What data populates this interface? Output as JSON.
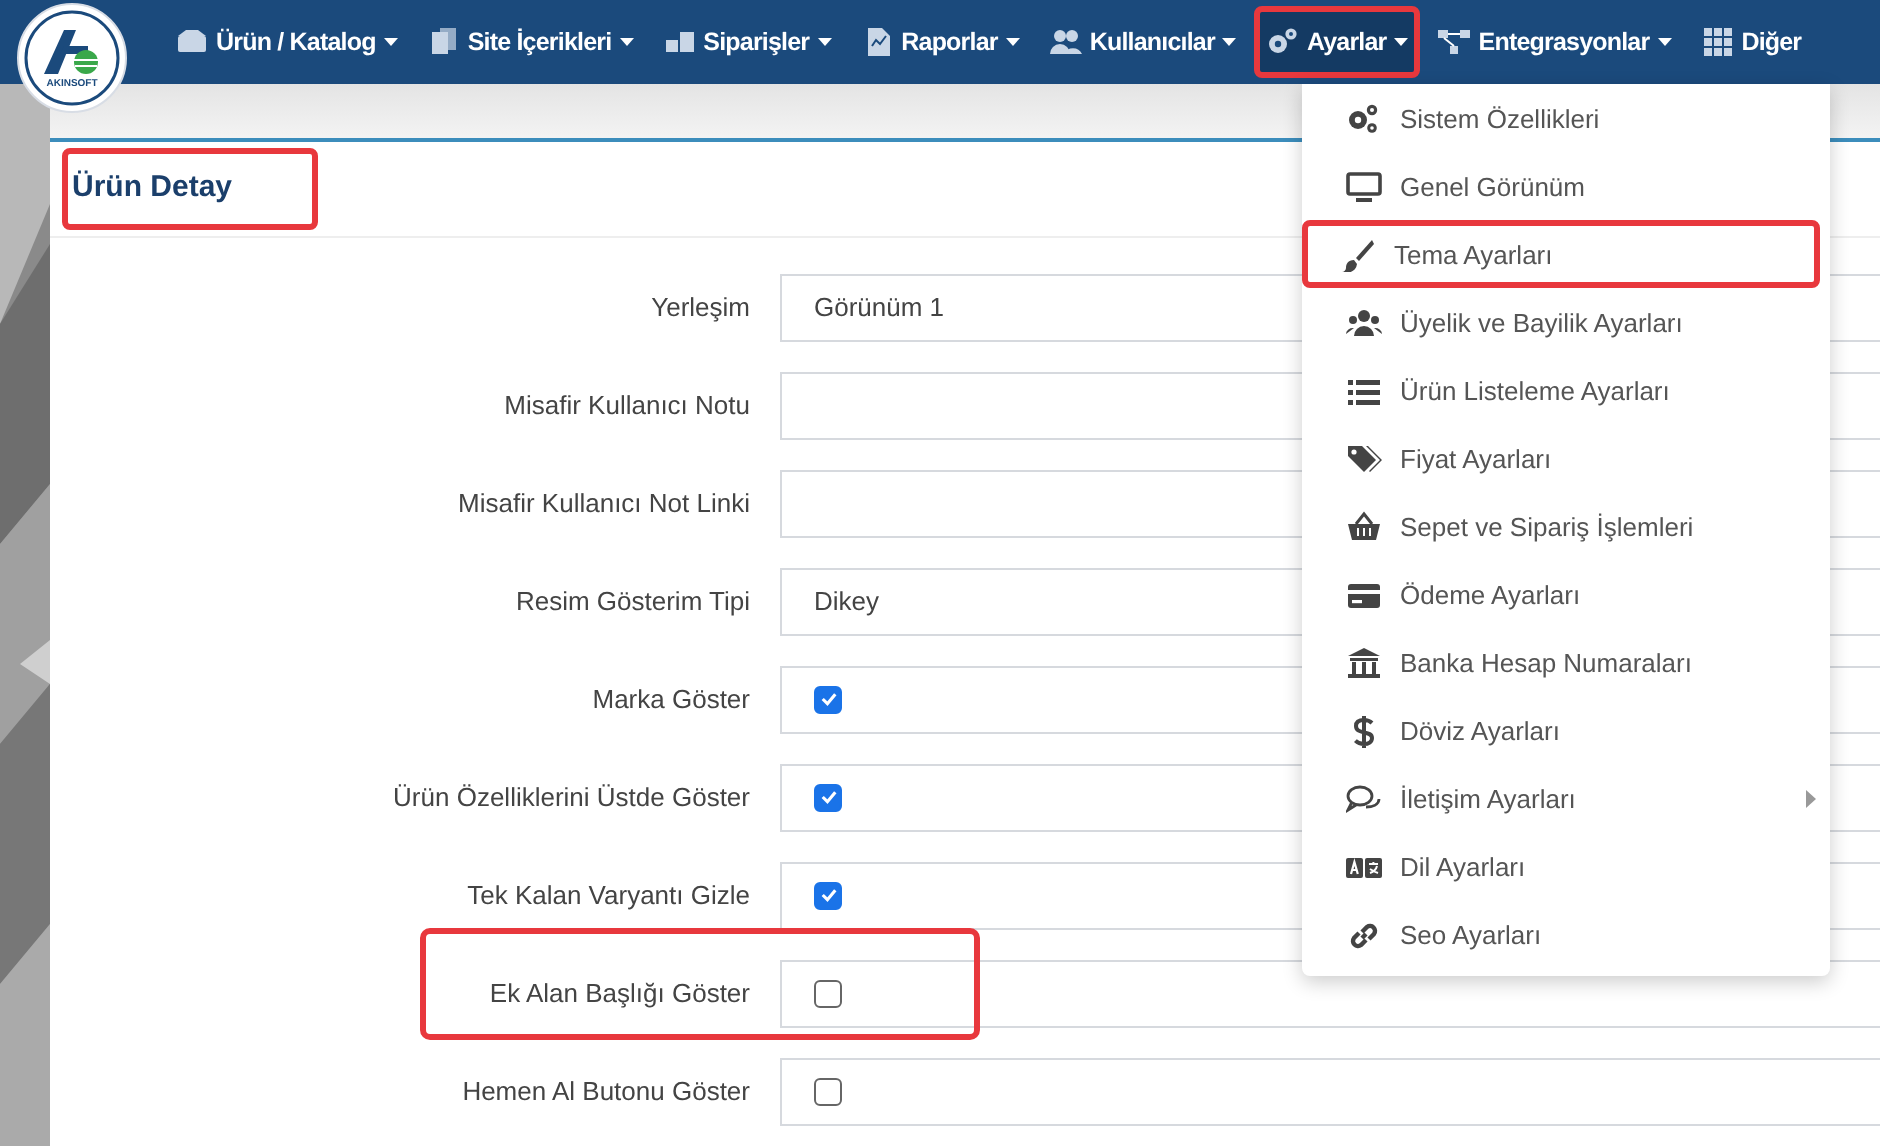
{
  "logo": {
    "text": "AKINSOFT"
  },
  "nav": [
    {
      "label": "Ürün / Katalog",
      "caret": true,
      "selected": false,
      "highlighted": false
    },
    {
      "label": "Site İçerikleri",
      "caret": true,
      "selected": false,
      "highlighted": false
    },
    {
      "label": "Siparişler",
      "caret": true,
      "selected": false,
      "highlighted": false
    },
    {
      "label": "Raporlar",
      "caret": true,
      "selected": false,
      "highlighted": false
    },
    {
      "label": "Kullanıcılar",
      "caret": true,
      "selected": false,
      "highlighted": false
    },
    {
      "label": "Ayarlar",
      "caret": true,
      "selected": true,
      "highlighted": true
    },
    {
      "label": "Entegrasyonlar",
      "caret": true,
      "selected": false,
      "highlighted": false
    },
    {
      "label": "Diğer",
      "caret": false,
      "selected": false,
      "highlighted": false
    }
  ],
  "panel": {
    "title": "Ürün Detay",
    "title_highlighted": true,
    "rows": [
      {
        "label": "Yerleşim",
        "kind": "select",
        "value": "Görünüm 1",
        "highlighted": false
      },
      {
        "label": "Misafir Kullanıcı Notu",
        "kind": "text",
        "value": "",
        "highlighted": false
      },
      {
        "label": "Misafir Kullanıcı Not Linki",
        "kind": "text",
        "value": "",
        "highlighted": false
      },
      {
        "label": "Resim Gösterim Tipi",
        "kind": "select",
        "value": "Dikey",
        "highlighted": false
      },
      {
        "label": "Marka Göster",
        "kind": "checkbox",
        "checked": true,
        "highlighted": false
      },
      {
        "label": "Ürün Özelliklerini Üstde Göster",
        "kind": "checkbox",
        "checked": true,
        "highlighted": false
      },
      {
        "label": "Tek Kalan Varyantı Gizle",
        "kind": "checkbox",
        "checked": true,
        "highlighted": false
      },
      {
        "label": "Ek Alan Başlığı Göster",
        "kind": "checkbox",
        "checked": false,
        "highlighted": true
      },
      {
        "label": "Hemen Al Butonu Göster",
        "kind": "checkbox",
        "checked": false,
        "highlighted": false
      }
    ]
  },
  "dropdown": {
    "items": [
      {
        "label": "Sistem Özellikleri",
        "highlighted": false,
        "submenu": false
      },
      {
        "label": "Genel Görünüm",
        "highlighted": false,
        "submenu": false
      },
      {
        "label": "Tema Ayarları",
        "highlighted": true,
        "submenu": false
      },
      {
        "label": "Üyelik ve Bayilik Ayarları",
        "highlighted": false,
        "submenu": false
      },
      {
        "label": "Ürün Listeleme Ayarları",
        "highlighted": false,
        "submenu": false
      },
      {
        "label": "Fiyat Ayarları",
        "highlighted": false,
        "submenu": false
      },
      {
        "label": "Sepet ve Sipariş İşlemleri",
        "highlighted": false,
        "submenu": false
      },
      {
        "label": "Ödeme Ayarları",
        "highlighted": false,
        "submenu": false
      },
      {
        "label": "Banka Hesap Numaraları",
        "highlighted": false,
        "submenu": false
      },
      {
        "label": "Döviz Ayarları",
        "highlighted": false,
        "submenu": false
      },
      {
        "label": "İletişim Ayarları",
        "highlighted": false,
        "submenu": true
      },
      {
        "label": "Dil Ayarları",
        "highlighted": false,
        "submenu": false
      },
      {
        "label": "Seo Ayarları",
        "highlighted": false,
        "submenu": false
      }
    ]
  }
}
